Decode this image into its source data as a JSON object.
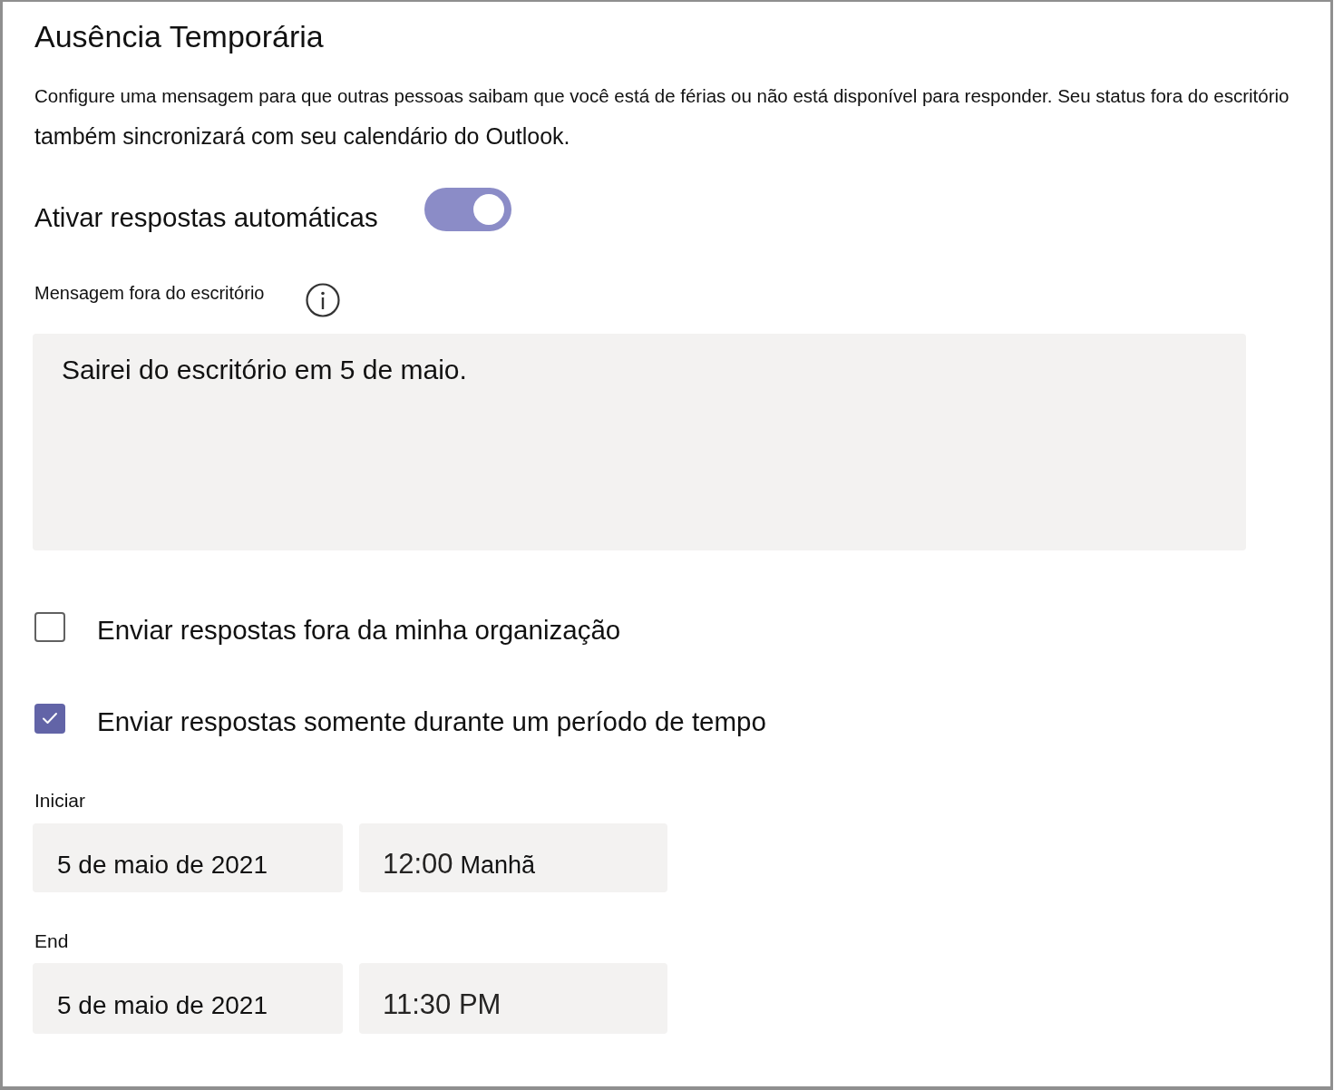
{
  "panel": {
    "title": "Ausência Temporária",
    "description_lines": [
      "Configure uma mensagem para que outras pessoas saibam que você está de férias ou não está disponível para responder. Seu status fora do escritório",
      "também sincronizará com seu calendário do Outlook."
    ],
    "auto_reply": {
      "label": "Ativar respostas automáticas",
      "on": true
    },
    "message": {
      "label": "Mensagem fora do escritório",
      "value": "Sairei do escritório em 5 de maio."
    },
    "options": [
      {
        "label": "Enviar respostas fora da minha organização",
        "checked": false
      },
      {
        "label": "Enviar respostas somente durante um período de tempo",
        "checked": true
      }
    ],
    "schedule": [
      {
        "label": "Iniciar",
        "date": "5 de maio de 2021",
        "time": "12:00",
        "period": "Manhã"
      },
      {
        "label": "End",
        "date": "5 de maio de 2021",
        "time": "11:30 PM"
      }
    ]
  }
}
